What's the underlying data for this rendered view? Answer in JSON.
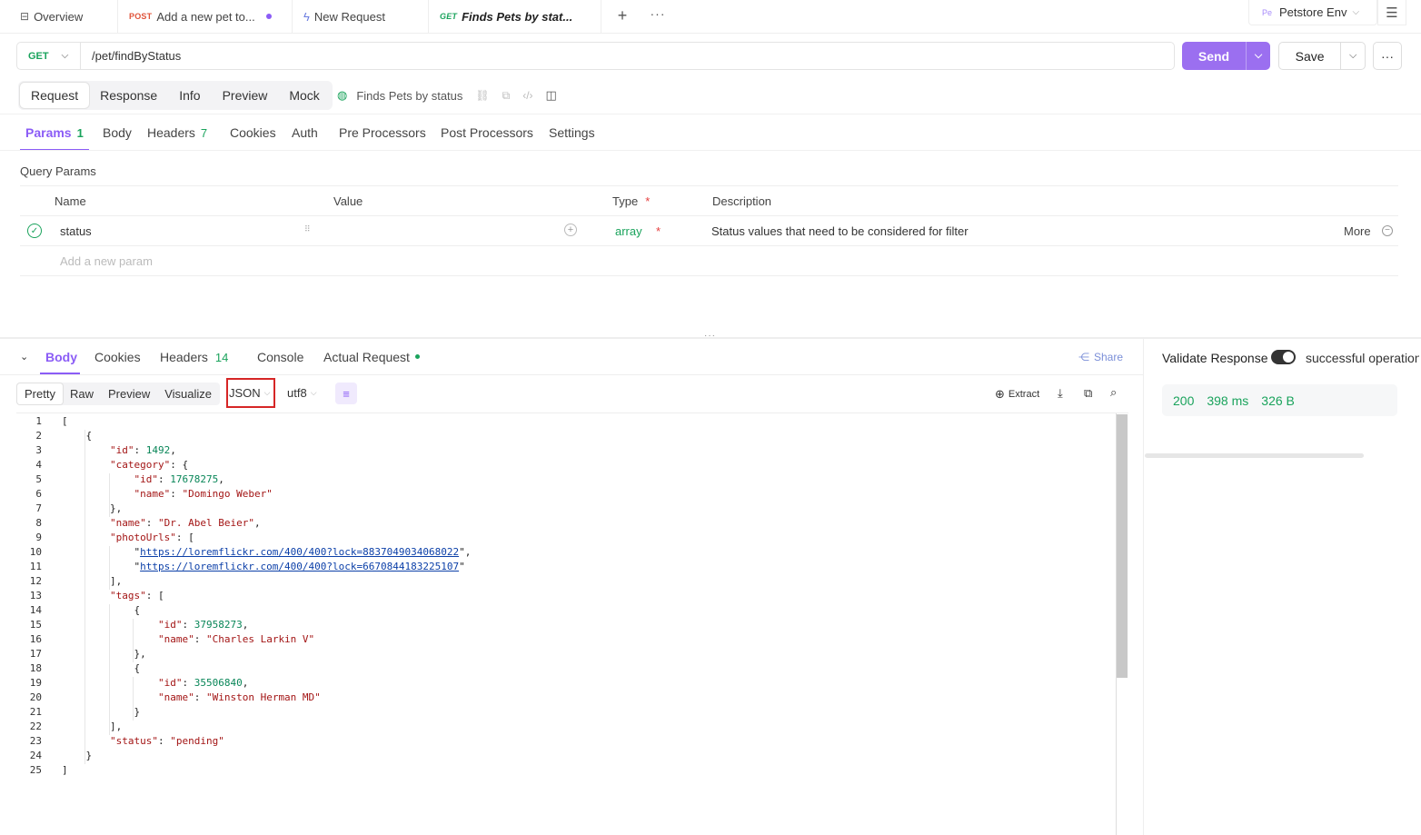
{
  "tabs": [
    {
      "method": "",
      "label": "Overview"
    },
    {
      "method": "POST",
      "label": "Add a new pet to..."
    },
    {
      "method": "",
      "label": "New Request"
    },
    {
      "method": "GET",
      "label": "Finds Pets by stat..."
    }
  ],
  "env": {
    "badge": "Pe",
    "label": "Petstore Env"
  },
  "request": {
    "method": "GET",
    "url": "/pet/findByStatus"
  },
  "buttons": {
    "send": "Send",
    "save": "Save"
  },
  "view_tabs": [
    "Request",
    "Response",
    "Info",
    "Preview",
    "Mock"
  ],
  "doc_title": "Finds Pets by status",
  "param_tabs": [
    {
      "label": "Params",
      "count": "1"
    },
    {
      "label": "Body",
      "count": ""
    },
    {
      "label": "Headers",
      "count": "7"
    },
    {
      "label": "Cookies",
      "count": ""
    },
    {
      "label": "Auth",
      "count": ""
    },
    {
      "label": "Pre Processors",
      "count": ""
    },
    {
      "label": "Post Processors",
      "count": ""
    },
    {
      "label": "Settings",
      "count": ""
    }
  ],
  "query_params": {
    "title": "Query Params",
    "headers": {
      "name": "Name",
      "value": "Value",
      "type": "Type",
      "required_mark": "*",
      "description": "Description"
    },
    "rows": [
      {
        "name": "status",
        "value": "",
        "type": "array",
        "required": "*",
        "description": "Status values that need to be considered for filter",
        "more": "More"
      }
    ],
    "add_placeholder": "Add a new param"
  },
  "response_tabs": [
    {
      "label": "Body",
      "count": ""
    },
    {
      "label": "Cookies",
      "count": ""
    },
    {
      "label": "Headers",
      "count": "14"
    },
    {
      "label": "Console",
      "count": ""
    },
    {
      "label": "Actual Request",
      "count": ""
    }
  ],
  "share_label": "Share",
  "format_tabs": [
    "Pretty",
    "Raw",
    "Preview",
    "Visualize"
  ],
  "format_select": "JSON",
  "encoding_select": "utf8",
  "extract_label": "Extract",
  "validate": {
    "label": "Validate Response",
    "value": "successful operation"
  },
  "status": {
    "code": "200",
    "time": "398 ms",
    "size": "326 B"
  },
  "colors": {
    "accent": "#8b5cf6",
    "success": "#1aa35c",
    "highlight": "#d62626"
  },
  "code_lines": [
    "[",
    "    {",
    "        \"id\": 1492,",
    "        \"category\": {",
    "            \"id\": 17678275,",
    "            \"name\": \"Domingo Weber\"",
    "        },",
    "        \"name\": \"Dr. Abel Beier\",",
    "        \"photoUrls\": [",
    "            \"https://loremflickr.com/400/400?lock=8837049034068022\",",
    "            \"https://loremflickr.com/400/400?lock=6670844183225107\"",
    "        ],",
    "        \"tags\": [",
    "            {",
    "                \"id\": 37958273,",
    "                \"name\": \"Charles Larkin V\"",
    "            },",
    "            {",
    "                \"id\": 35506840,",
    "                \"name\": \"Winston Herman MD\"",
    "            }",
    "        ],",
    "        \"status\": \"pending\"",
    "    }",
    "]"
  ]
}
